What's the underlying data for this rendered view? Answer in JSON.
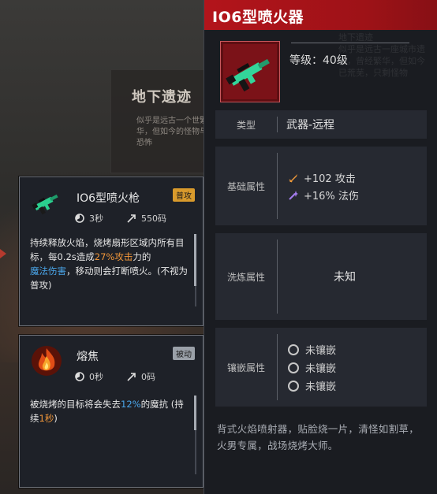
{
  "background": {
    "card_title": "地下遗迹",
    "card_text": "似乎是远古一个世繁华，但如今的怪物与恐怖",
    "ghost_title": "地下遗迹",
    "ghost_text": "似乎是远古一座城市遗迹，曾经繁华，但如今已荒芜，只剩怪物"
  },
  "skill_cards": [
    {
      "name": "IO6型喷火枪",
      "tag": "普攻",
      "cooldown": "3秒",
      "range": "550码",
      "desc_parts": [
        {
          "text": "持续释放火焰，烧烤扇形区域内所有目标，每0.2s造成",
          "style": "normal"
        },
        {
          "text": "27%攻击",
          "style": "orange"
        },
        {
          "text": "力的",
          "style": "normal"
        },
        {
          "text": "魔法伤害",
          "style": "blue"
        },
        {
          "text": "，移动则会打断喷火。(不视为普攻)",
          "style": "normal"
        }
      ]
    },
    {
      "name": "熔焦",
      "tag": "被动",
      "cooldown": "0秒",
      "range": "0码",
      "desc_parts": [
        {
          "text": "被烧烤的目标将会失去",
          "style": "normal"
        },
        {
          "text": "12%",
          "style": "blue"
        },
        {
          "text": "的魔抗 (持续",
          "style": "normal"
        },
        {
          "text": "1秒",
          "style": "orange"
        },
        {
          "text": ")",
          "style": "normal"
        }
      ]
    }
  ],
  "item": {
    "title": "IO6型喷火器",
    "level_label": "等级：40级",
    "rows": {
      "type_label": "类型",
      "type_value": "武器-远程",
      "base_label": "基础属性",
      "base_attrs": [
        "+102 攻击",
        "+16% 法伤"
      ],
      "refine_label": "洗炼属性",
      "refine_value": "未知",
      "socket_label": "镶嵌属性",
      "sockets": [
        "未镶嵌",
        "未镶嵌",
        "未镶嵌"
      ]
    },
    "description": "背式火焰喷射器，贴脸烧一片，清怪如割草，火男专属，战场烧烤大师。"
  },
  "colors": {
    "title_red": "#b3141b",
    "highlight_orange": "#f0963a",
    "highlight_blue": "#4aa6ea",
    "weapon_green": "#33d59a"
  }
}
